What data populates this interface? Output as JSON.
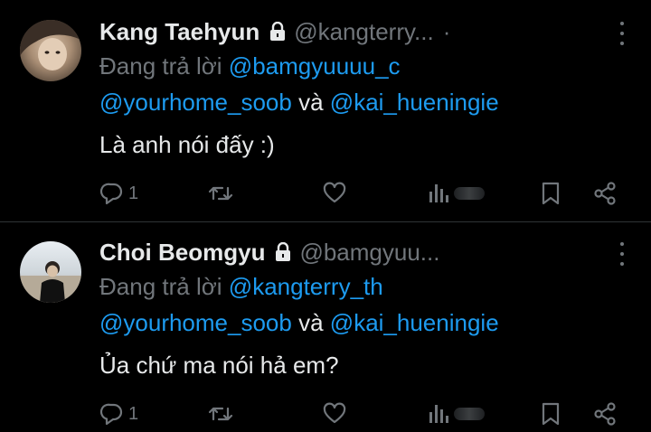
{
  "tweets": [
    {
      "name": "Kang Taehyun",
      "handle": "@kangterry...",
      "replying_prefix": "Đang trả lời",
      "mention_1": "@bamgyuuuu_c",
      "mention_2": "@yourhome_soob",
      "conjunction": "và",
      "mention_3": "@kai_hueningie",
      "text": "Là anh nói đấy :)",
      "reply_count": "1"
    },
    {
      "name": "Choi Beomgyu",
      "handle": "@bamgyuu...",
      "replying_prefix": "Đang trả lời",
      "mention_1": "@kangterry_th",
      "mention_2": "@yourhome_soob",
      "conjunction": "và",
      "mention_3": "@kai_hueningie",
      "text": "Ủa chứ ma nói hả em?",
      "reply_count": "1"
    }
  ],
  "separator_dot": "·",
  "colors": {
    "background": "#000000",
    "text": "#e7e9ea",
    "muted": "#71767b",
    "link": "#1d9bf0",
    "divider": "#2f3336"
  },
  "icons": [
    "lock-icon",
    "more-icon",
    "reply-icon",
    "retweet-icon",
    "like-icon",
    "views-icon",
    "bookmark-icon",
    "share-icon"
  ]
}
